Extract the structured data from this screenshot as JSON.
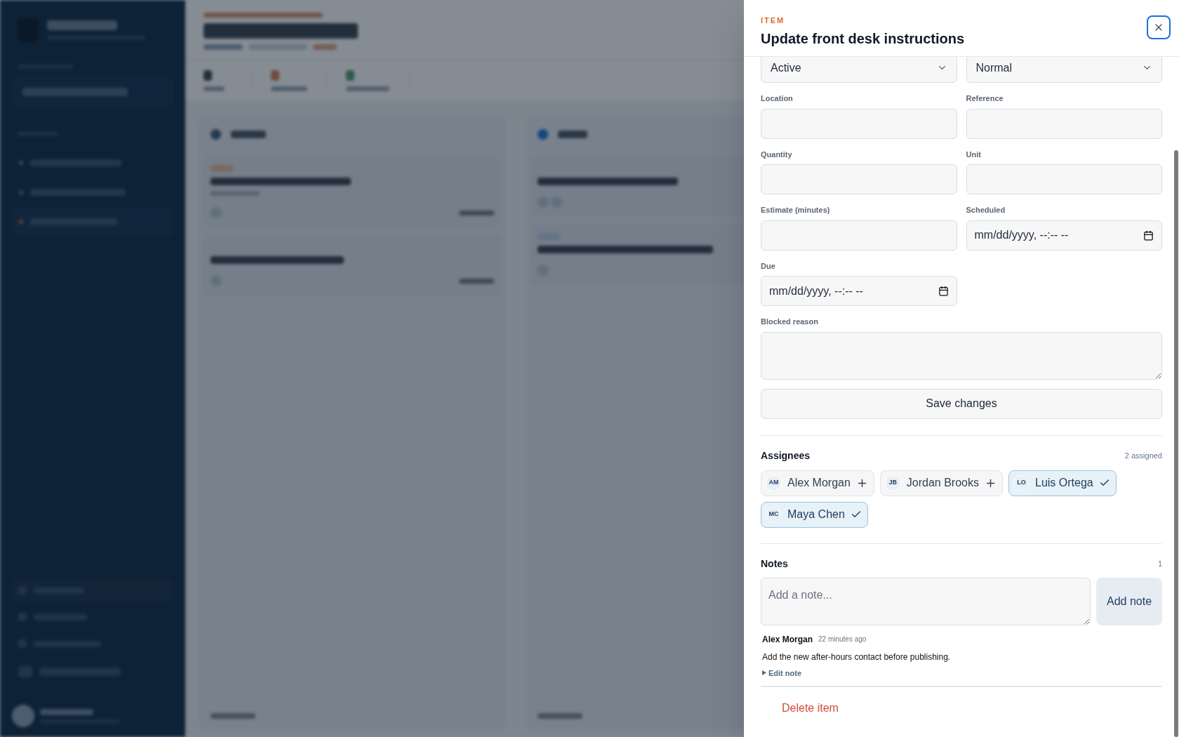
{
  "drawer": {
    "eyebrow": "ITEM",
    "title": "Update front desk instructions",
    "fields": [
      {
        "kind": "select",
        "value": "Active"
      },
      {
        "kind": "select",
        "value": "Normal"
      },
      {
        "kind": "text",
        "label": "Location"
      },
      {
        "kind": "text",
        "label": "Reference"
      },
      {
        "kind": "text",
        "label": "Quantity"
      },
      {
        "kind": "text",
        "label": "Unit"
      },
      {
        "kind": "text",
        "label": "Estimate (minutes)"
      },
      {
        "kind": "datetime",
        "label": "Scheduled",
        "value": "mm/dd/yyyy, --:-- --"
      },
      {
        "kind": "datetime",
        "label": "Due",
        "value": "mm/dd/yyyy, --:-- --"
      },
      {
        "kind": "textarea",
        "label": "Blocked reason"
      }
    ],
    "save": "Save changes",
    "assignees_title": "Assignees",
    "assignees_count": "2 assigned",
    "assignees": [
      {
        "initials": "AM",
        "name": "Alex Morgan",
        "selected": false
      },
      {
        "initials": "JB",
        "name": "Jordan Brooks",
        "selected": false
      },
      {
        "initials": "LO",
        "name": "Luis Ortega",
        "selected": true
      },
      {
        "initials": "MC",
        "name": "Maya Chen",
        "selected": true
      }
    ],
    "notes_title": "Notes",
    "notes_count": "1",
    "note_placeholder": "Add a note...",
    "add_note": "Add note",
    "notes": [
      {
        "author": "Alex Morgan",
        "time": "22 minutes ago",
        "body": "Add the new after-hours contact before publishing.",
        "edit": "Edit note"
      }
    ],
    "delete": "Delete item"
  }
}
